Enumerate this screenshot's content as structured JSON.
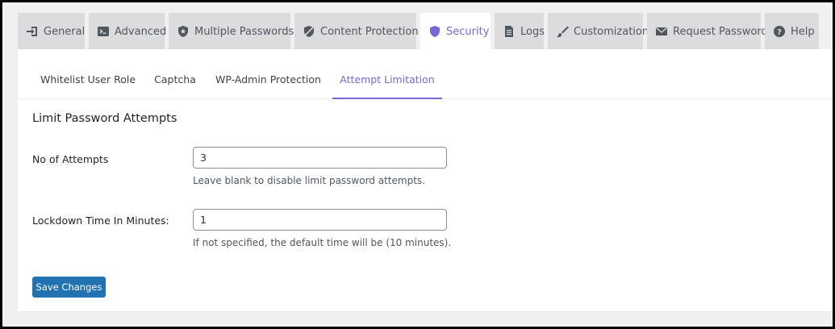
{
  "tabs": [
    {
      "label": "General",
      "icon": "sign-in-icon",
      "active": false
    },
    {
      "label": "Advanced",
      "icon": "terminal-icon",
      "active": false
    },
    {
      "label": "Multiple Passwords",
      "icon": "shield-icon",
      "active": false
    },
    {
      "label": "Content Protection",
      "icon": "no-tracking-icon",
      "active": false
    },
    {
      "label": "Security",
      "icon": "shield-icon",
      "active": true
    },
    {
      "label": "Logs",
      "icon": "document-icon",
      "active": false
    },
    {
      "label": "Customization",
      "icon": "paintbrush-icon",
      "active": false
    },
    {
      "label": "Request Password",
      "icon": "email-icon",
      "active": false
    },
    {
      "label": "Help",
      "icon": "help-icon",
      "active": false
    }
  ],
  "subtabs": [
    {
      "label": "Whitelist User Role",
      "active": false
    },
    {
      "label": "Captcha",
      "active": false
    },
    {
      "label": "WP-Admin Protection",
      "active": false
    },
    {
      "label": "Attempt Limitation",
      "active": true
    }
  ],
  "section": {
    "title": "Limit Password Attempts"
  },
  "fields": {
    "attempts": {
      "label": "No of Attempts",
      "value": "3",
      "help": "Leave blank to disable limit password attempts."
    },
    "lockdown": {
      "label": "Lockdown Time In Minutes:",
      "value": "1",
      "help": "If not specified, the default time will be (10 minutes)."
    }
  },
  "save_button": {
    "label": "Save Changes"
  },
  "colors": {
    "accent": "#7b66d9",
    "primary_button": "#2271b1",
    "tab_inactive_bg": "#dcdcde",
    "page_bg": "#f0f0f1"
  }
}
